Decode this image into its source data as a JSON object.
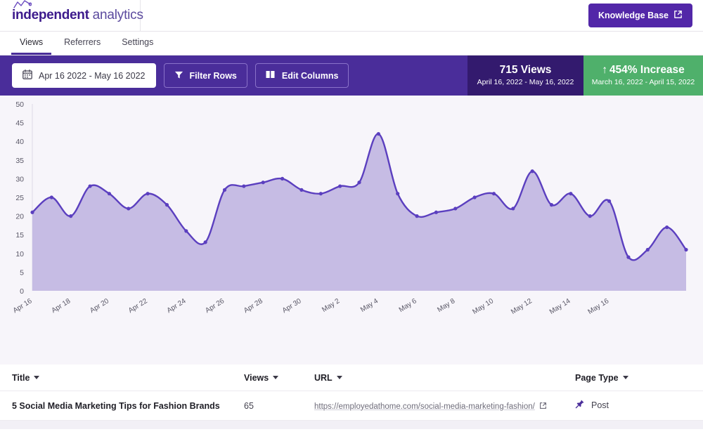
{
  "header": {
    "logo_bold": "independent",
    "logo_light": "analytics",
    "logo_icon": "line-chart-spark-icon",
    "knowledge_base_label": "Knowledge Base",
    "knowledge_base_icon": "external-link-icon",
    "accent_purple": "#5227a8"
  },
  "tabs": [
    {
      "label": "Views",
      "active": true
    },
    {
      "label": "Referrers",
      "active": false
    },
    {
      "label": "Settings",
      "active": false
    }
  ],
  "toolbar": {
    "background": "#4a2d9a",
    "date_range_label": "Apr 16 2022 - May 16 2022",
    "date_range_icon": "calendar-icon",
    "filter_rows_label": "Filter Rows",
    "filter_rows_icon": "funnel-icon",
    "edit_columns_label": "Edit Columns",
    "edit_columns_icon": "columns-icon"
  },
  "stats": {
    "views": {
      "value": "715 Views",
      "range": "April 16, 2022 - May 16, 2022",
      "background": "#331a6e"
    },
    "increase": {
      "arrow": "↑",
      "value": "454% Increase",
      "range": "March 16, 2022 - April 15, 2022",
      "background": "#4fb06b"
    }
  },
  "chart_data": {
    "type": "area",
    "title": "",
    "xlabel": "",
    "ylabel": "",
    "ylim": [
      0,
      50
    ],
    "yticks": [
      0,
      5,
      10,
      15,
      20,
      25,
      30,
      35,
      40,
      45,
      50
    ],
    "grid": false,
    "legend_position": "none",
    "line_color": "#5b3fbf",
    "fill_color": "#c6bce4",
    "plot_background": "#f7f5fa",
    "x_tick_labels": [
      "Apr 16",
      "Apr 18",
      "Apr 20",
      "Apr 22",
      "Apr 24",
      "Apr 26",
      "Apr 28",
      "Apr 30",
      "May 2",
      "May 4",
      "May 6",
      "May 8",
      "May 10",
      "May 12",
      "May 14",
      "May 16"
    ],
    "x": [
      "Apr 16",
      "Apr 17",
      "Apr 18",
      "Apr 19",
      "Apr 20",
      "Apr 21",
      "Apr 22",
      "Apr 23",
      "Apr 24",
      "Apr 25",
      "Apr 26",
      "Apr 27",
      "Apr 28",
      "Apr 29",
      "Apr 30",
      "May 1",
      "May 2",
      "May 3",
      "May 4",
      "May 5",
      "May 6",
      "May 7",
      "May 8",
      "May 9",
      "May 10",
      "May 11",
      "May 12",
      "May 13",
      "May 14",
      "May 15",
      "May 16"
    ],
    "values": [
      21,
      25,
      20,
      28,
      26,
      22,
      26,
      23,
      16,
      13,
      27,
      28,
      29,
      30,
      27,
      26,
      28,
      29,
      42,
      26,
      20,
      21,
      22,
      25,
      26,
      22,
      32,
      23,
      26,
      20,
      24,
      9,
      11,
      17,
      11
    ],
    "series": [
      {
        "name": "Views",
        "values": [
          21,
          25,
          20,
          28,
          26,
          22,
          26,
          23,
          16,
          13,
          27,
          28,
          29,
          30,
          27,
          26,
          28,
          29,
          42,
          26,
          20,
          21,
          22,
          25,
          26,
          22,
          32,
          23,
          26,
          20,
          24,
          9,
          11,
          17,
          11
        ]
      }
    ]
  },
  "table": {
    "columns": [
      {
        "label": "Title",
        "sort_icon": "caret-down-icon"
      },
      {
        "label": "Views",
        "sort_icon": "caret-down-icon"
      },
      {
        "label": "URL",
        "sort_icon": "caret-down-icon"
      },
      {
        "label": "Page Type",
        "sort_icon": "caret-down-icon"
      }
    ],
    "rows": [
      {
        "title": "5 Social Media Marketing Tips for Fashion Brands",
        "views": "65",
        "url": "https://employedathome.com/social-media-marketing-fashion/",
        "url_icon": "external-link-icon",
        "page_type": "Post",
        "page_type_icon": "pin-icon"
      }
    ]
  }
}
